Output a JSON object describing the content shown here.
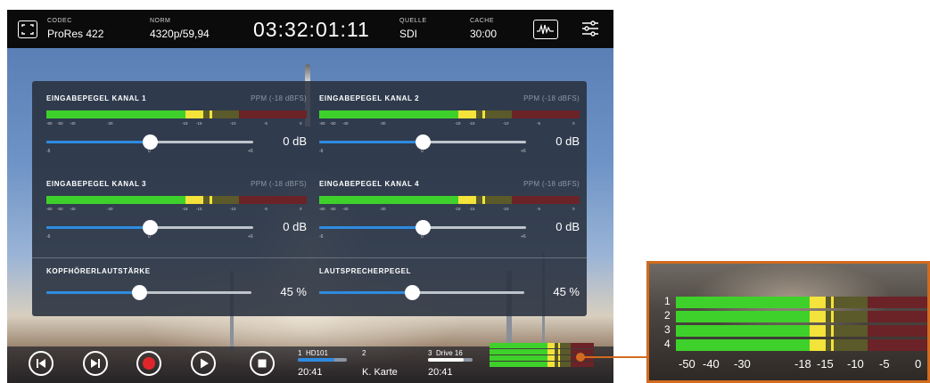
{
  "topbar": {
    "codec_caption": "CODEC",
    "codec_value": "ProRes 422",
    "norm_caption": "NORM",
    "norm_value": "4320p/59,94",
    "timecode": "03:32:01:11",
    "source_caption": "QUELLE",
    "source_value": "SDI",
    "cache_caption": "CACHE",
    "cache_value": "30:00",
    "icons": [
      "fullscreen-icon",
      "waveform-icon",
      "settings-sliders-icon"
    ]
  },
  "audio_panel": {
    "channels": [
      {
        "title": "EINGABEPEGEL KANAL 1",
        "ppm": "PPM (-18 dBFS)",
        "gain": "0 dB",
        "slider_min": "-6",
        "slider_zero": "0",
        "slider_max": "+6",
        "slider_level": 0.5
      },
      {
        "title": "EINGABEPEGEL KANAL 2",
        "ppm": "PPM (-18 dBFS)",
        "gain": "0 dB",
        "slider_min": "-6",
        "slider_zero": "0",
        "slider_max": "+6",
        "slider_level": 0.5
      },
      {
        "title": "EINGABEPEGEL KANAL 3",
        "ppm": "PPM (-18 dBFS)",
        "gain": "0 dB",
        "slider_min": "-6",
        "slider_zero": "0",
        "slider_max": "+6",
        "slider_level": 0.5
      },
      {
        "title": "EINGABEPEGEL KANAL 4",
        "ppm": "PPM (-18 dBFS)",
        "gain": "0 dB",
        "slider_min": "-6",
        "slider_zero": "0",
        "slider_max": "+6",
        "slider_level": 0.5
      }
    ],
    "meter_ticks": [
      "-60",
      "-50",
      "-40",
      "-30",
      "-18",
      "-15",
      "-10",
      "-5",
      "0"
    ],
    "headphone_title": "KOPFHÖRERLAUTSTÄRKE",
    "headphone_value": "45 %",
    "headphone_level": 0.45,
    "speaker_title": "LAUTSPRECHERPEGEL",
    "speaker_value": "45 %",
    "speaker_level": 0.45
  },
  "transport": {
    "buttons": [
      "skip-back",
      "skip-forward",
      "record",
      "play",
      "stop"
    ],
    "media": [
      {
        "slot": "1",
        "name": "HD101",
        "time": "20:41",
        "fill": 0.75
      },
      {
        "slot": "2",
        "name": "",
        "time": "K. Karte",
        "fill": 0
      },
      {
        "slot": "3",
        "name": "Drive 16",
        "time": "20:41",
        "fill": 0.8
      }
    ]
  },
  "zoom_meter": {
    "rows": [
      "1",
      "2",
      "3",
      "4"
    ],
    "ticks": [
      "-50",
      "-40",
      "-30",
      "-18",
      "-15",
      "-10",
      "-5",
      "0"
    ]
  },
  "colors": {
    "meter_green": "#3fd12b",
    "meter_yellow": "#f3e33a",
    "meter_olive": "#5b5a2a",
    "meter_red": "#6b2327",
    "accent_blue": "#2f8be0",
    "record_red": "#e0262b",
    "callout_orange": "#d36b1f"
  }
}
